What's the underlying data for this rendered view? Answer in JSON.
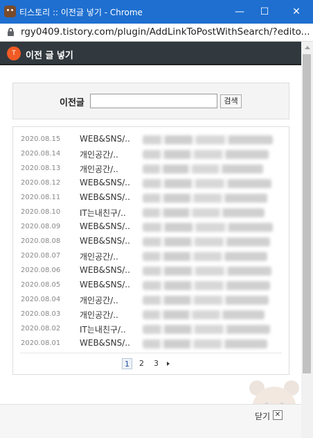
{
  "window": {
    "title": "티스토리 :: 이전글 넣기 - Chrome",
    "minimize_glyph": "—",
    "maximize_glyph": "☐",
    "close_glyph": "✕"
  },
  "address_bar": {
    "url": "rgy0409.tistory.com/plugin/AddLinkToPostWithSearch/?edito..."
  },
  "header": {
    "title": "이전 글 넣기",
    "logo_glyph": "T"
  },
  "search": {
    "label": "이전글",
    "input_value": "",
    "button_label": "검색"
  },
  "posts": [
    {
      "date": "2020.08.15",
      "category": "WEB&SNS/.."
    },
    {
      "date": "2020.08.14",
      "category": "개인공간/.."
    },
    {
      "date": "2020.08.13",
      "category": "개인공간/.."
    },
    {
      "date": "2020.08.12",
      "category": "WEB&SNS/.."
    },
    {
      "date": "2020.08.11",
      "category": "WEB&SNS/.."
    },
    {
      "date": "2020.08.10",
      "category": "IT는내친구/.."
    },
    {
      "date": "2020.08.09",
      "category": "WEB&SNS/.."
    },
    {
      "date": "2020.08.08",
      "category": "WEB&SNS/.."
    },
    {
      "date": "2020.08.07",
      "category": "개인공간/.."
    },
    {
      "date": "2020.08.06",
      "category": "WEB&SNS/.."
    },
    {
      "date": "2020.08.05",
      "category": "WEB&SNS/.."
    },
    {
      "date": "2020.08.04",
      "category": "개인공간/.."
    },
    {
      "date": "2020.08.03",
      "category": "개인공간/.."
    },
    {
      "date": "2020.08.02",
      "category": "IT는내친구/.."
    },
    {
      "date": "2020.08.01",
      "category": "WEB&SNS/.."
    }
  ],
  "pagination": {
    "pages": [
      "1",
      "2",
      "3"
    ],
    "current": "1"
  },
  "footer": {
    "close_label": "닫기",
    "close_glyph": "✕"
  }
}
